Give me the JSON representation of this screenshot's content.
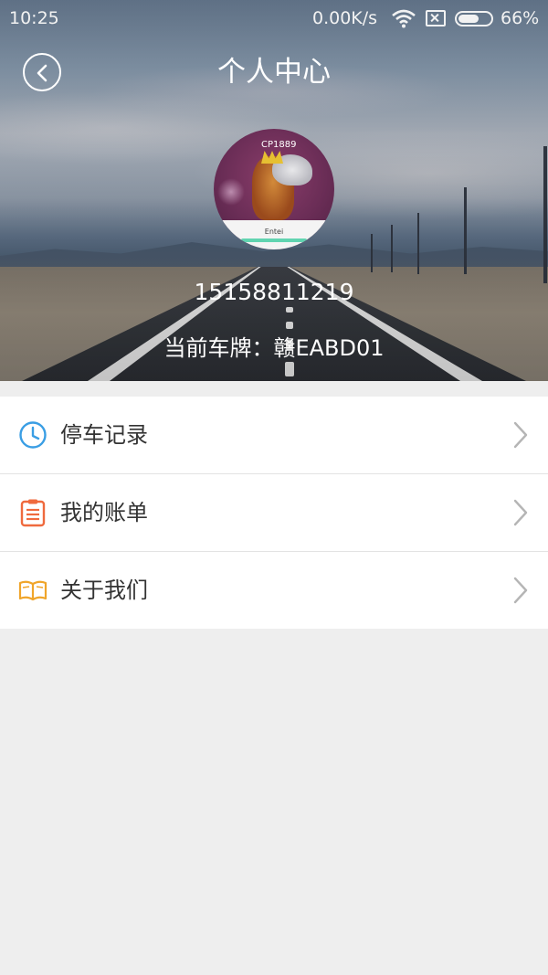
{
  "status_bar": {
    "time": "10:25",
    "network_speed": "0.00K/s",
    "battery_percent": "66%",
    "battery_level": 0.66,
    "icons": [
      "wifi-icon",
      "no-sim-icon",
      "battery-icon"
    ]
  },
  "header": {
    "title": "个人中心",
    "back_icon": "chevron-left-icon"
  },
  "profile": {
    "avatar_cp_text": "CP1889",
    "avatar_name_text": "Entei",
    "phone": "15158811219",
    "plate_line": "当前车牌：赣EABD01"
  },
  "menu": {
    "items": [
      {
        "label": "停车记录",
        "icon": "clock-icon",
        "icon_color": "#3a9ee4"
      },
      {
        "label": "我的账单",
        "icon": "clipboard-icon",
        "icon_color": "#ef6a3e"
      },
      {
        "label": "关于我们",
        "icon": "book-icon",
        "icon_color": "#f0a52a"
      }
    ],
    "chevron_icon": "chevron-right-icon"
  },
  "colors": {
    "page_background": "#eeeeee",
    "list_background": "#ffffff",
    "text": "#333333",
    "divider": "#e3e3e3",
    "chevron": "#b5b5b5"
  }
}
